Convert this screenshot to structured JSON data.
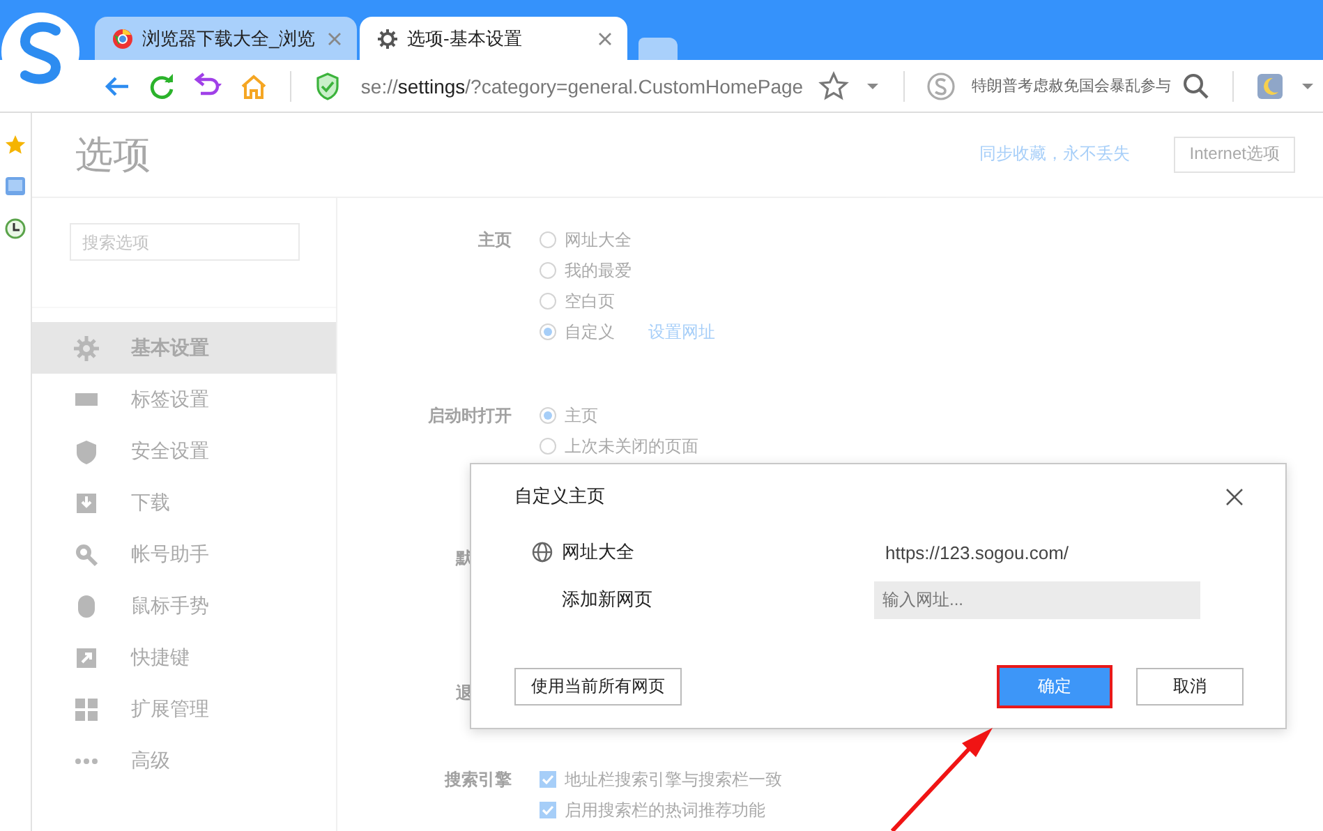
{
  "browser": {
    "tabs": [
      {
        "title": "浏览器下载大全_浏览",
        "selected": false
      },
      {
        "title": "选项-基本设置",
        "selected": true
      }
    ],
    "address": "se://**settings**/?category=general.CustomHomePage",
    "search": {
      "value": "特朗普考虑赦免国会暴乱参与"
    }
  },
  "page": {
    "title": "选项",
    "sync_text": "同步收藏，永不丢失",
    "header_buttons": [
      "Internet选项"
    ],
    "search": {
      "placeholder": "搜索选项"
    },
    "nav": [
      {
        "label": "基本设置",
        "selected": true
      },
      {
        "label": "标签设置",
        "selected": false
      },
      {
        "label": "安全设置",
        "selected": false
      },
      {
        "label": "下载",
        "selected": false
      },
      {
        "label": "帐号助手",
        "selected": false
      },
      {
        "label": "鼠标手势",
        "selected": false
      },
      {
        "label": "快捷键",
        "selected": false
      },
      {
        "label": "扩展管理",
        "selected": false
      },
      {
        "label": "高级",
        "selected": false
      }
    ],
    "sections": [
      {
        "label": "主页",
        "options": [
          {
            "kind": "radio",
            "label": "网址大全",
            "selected": false
          },
          {
            "kind": "radio",
            "label": "我的最爱",
            "selected": false
          },
          {
            "kind": "radio",
            "label": "空白页",
            "selected": false
          },
          {
            "kind": "radio",
            "label": "自定义",
            "selected": true,
            "link": "设置网址"
          }
        ]
      },
      {
        "label": "启动时打开",
        "options": [
          {
            "kind": "radio",
            "label": "主页",
            "selected": true
          },
          {
            "kind": "radio",
            "label": "上次未关闭的页面",
            "selected": false
          }
        ]
      },
      {
        "label": "默"
      },
      {
        "label": "退"
      },
      {
        "label": "搜索引擎",
        "options": [
          {
            "kind": "checkbox",
            "label": "地址栏搜索引擎与搜索栏一致",
            "checked": true
          },
          {
            "kind": "checkbox",
            "label": "启用搜索栏的热词推荐功能",
            "checked": true
          }
        ]
      }
    ]
  },
  "dialog": {
    "title": "自定义主页",
    "entries": [
      {
        "name": "网址大全",
        "url": "https://123.sogou.com/"
      }
    ],
    "add": {
      "label": "添加新网页",
      "placeholder": "输入网址..."
    },
    "buttons": [
      {
        "label": "使用当前所有网页",
        "kind": "secondary",
        "highlighted": false
      },
      {
        "label": "确定",
        "kind": "primary",
        "highlighted": true
      },
      {
        "label": "取消",
        "kind": "secondary",
        "highlighted": false
      }
    ]
  }
}
